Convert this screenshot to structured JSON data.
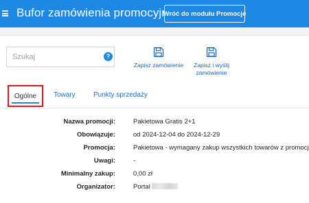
{
  "header": {
    "title": "Bufor zamówienia promocyjnego",
    "back_button": "Wróć do modułu Promocje"
  },
  "search": {
    "placeholder": "Szukaj",
    "value": "",
    "help_glyph": "?"
  },
  "actions": {
    "save": "Zapisz zamówienie",
    "save_send_line1": "Zapisz i wyślij",
    "save_send_line2": "zamówienie"
  },
  "tabs": {
    "general": "Ogólne",
    "goods": "Towary",
    "points": "Punkty sprzedaży",
    "active": "general"
  },
  "details": [
    {
      "label": "Nazwa promocji:",
      "value": "Pakietowa Gratis 2+1"
    },
    {
      "label": "Obowiązuje:",
      "value": "od 2024-12-04 do 2024-12-29"
    },
    {
      "label": "Promocja:",
      "value": "Pakietowa - wymagany zakup wszystkich towarów z promocji"
    },
    {
      "label": "Uwagi:",
      "value": "-"
    },
    {
      "label": "Minimalny zakup:",
      "value": "0,00 zł"
    },
    {
      "label": "Organizator:",
      "value": "Portal"
    }
  ],
  "colors": {
    "header_bg": "#1e88e5",
    "accent": "#1e88e5",
    "highlight_box": "#e0141b"
  },
  "icons": {
    "menu": "hamburger-icon",
    "help": "help-icon",
    "save": "floppy-disk-icon",
    "save_send": "floppy-disk-icon"
  }
}
